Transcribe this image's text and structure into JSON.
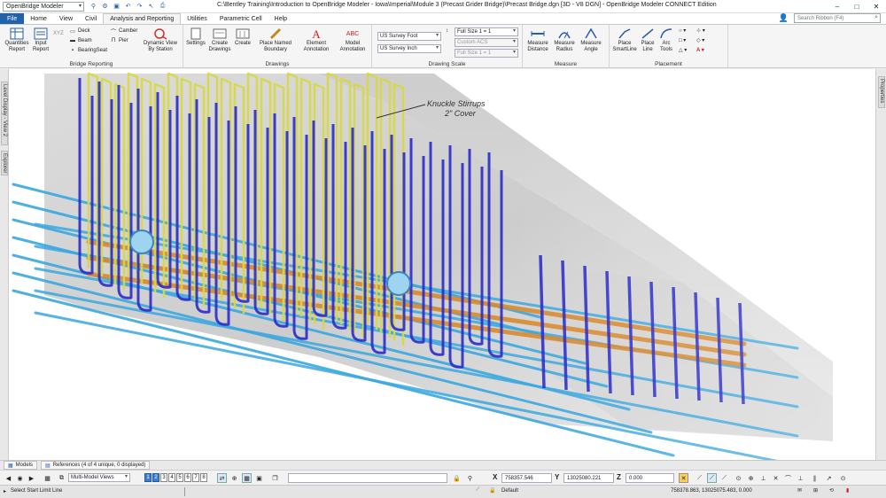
{
  "titlebar": {
    "workspace": "OpenBridge Modeler",
    "title": "C:\\Bentley Training\\Introduction to OpenBridge Modeler - Iowa\\Imperial\\Module 3 (Precast Grider Bridge)\\Precast Bridge.dgn [3D - V8 DGN] - OpenBridge Modeler CONNECT Edition",
    "minimize": "–",
    "maximize": "□",
    "close": "✕"
  },
  "tabs": {
    "file": "File",
    "items": [
      "Home",
      "View",
      "Civil",
      "Analysis and Reporting",
      "Utilities",
      "Parametric Cell",
      "Help"
    ],
    "active": "Analysis and Reporting",
    "search_placeholder": "Search Ribbon (F4)"
  },
  "ribbon": {
    "bridge_reporting": {
      "label": "Bridge Reporting",
      "quantities": "Quantities Report",
      "input": "Input Report",
      "xyz": "XYZ",
      "deck": "Deck",
      "beam": "Beam",
      "bearingseat": "BearingSeat",
      "camber": "Camber",
      "pier": "Pier",
      "dynamic_view": "Dynamic View By Station"
    },
    "drawings": {
      "label": "Drawings",
      "settings": "Settings",
      "create_drawings": "Create Drawings",
      "create": "Create",
      "place_named_boundary": "Place Named Boundary",
      "element_annotation": "Element Annotation",
      "model_annotation": "Model Annotation"
    },
    "drawing_scale": {
      "label": "Drawing Scale",
      "units1": "US Survey Foot",
      "units2": "US Survey Inch",
      "scale1": "Full Size 1 = 1",
      "acs": "Custom ACS",
      "scale2": "Full Size 1 = 1"
    },
    "measure": {
      "label": "Measure",
      "distance": "Measure Distance",
      "radius": "Measure Radius",
      "angle": "Measure Angle"
    },
    "placement": {
      "label": "Placement",
      "smartline": "Place SmartLine",
      "line": "Place Line",
      "arc": "Arc Tools"
    }
  },
  "sidetabs": {
    "left1": "Level Display - View 2",
    "left2": "Explorer",
    "right": "Properties"
  },
  "viewport": {
    "annotation_line1": "Knuckle Stirrups",
    "annotation_line2": "2\" Cover"
  },
  "panels": {
    "models": "Models",
    "references": "References (4 of 4 unique, 0 displayed)"
  },
  "toolbar": {
    "multi_model": "Multi-Model Views",
    "view_numbers": [
      "1",
      "2",
      "3",
      "4",
      "5",
      "6",
      "7",
      "8"
    ],
    "x_label": "X",
    "x_value": "758357.546",
    "y_label": "Y",
    "y_value": "13025080.221",
    "z_label": "Z",
    "z_value": "0.000"
  },
  "status": {
    "prompt": "Select Start Limit Line",
    "level": "Default",
    "coords": "758378.863, 13025075.483, 0.000"
  },
  "colors": {
    "accent": "#1f62ad",
    "rebar_blue": "#2a2bc9",
    "rebar_cyan": "#3aa8e0",
    "rebar_yellow": "#d8d840",
    "strand_orange": "#d98a2e"
  }
}
